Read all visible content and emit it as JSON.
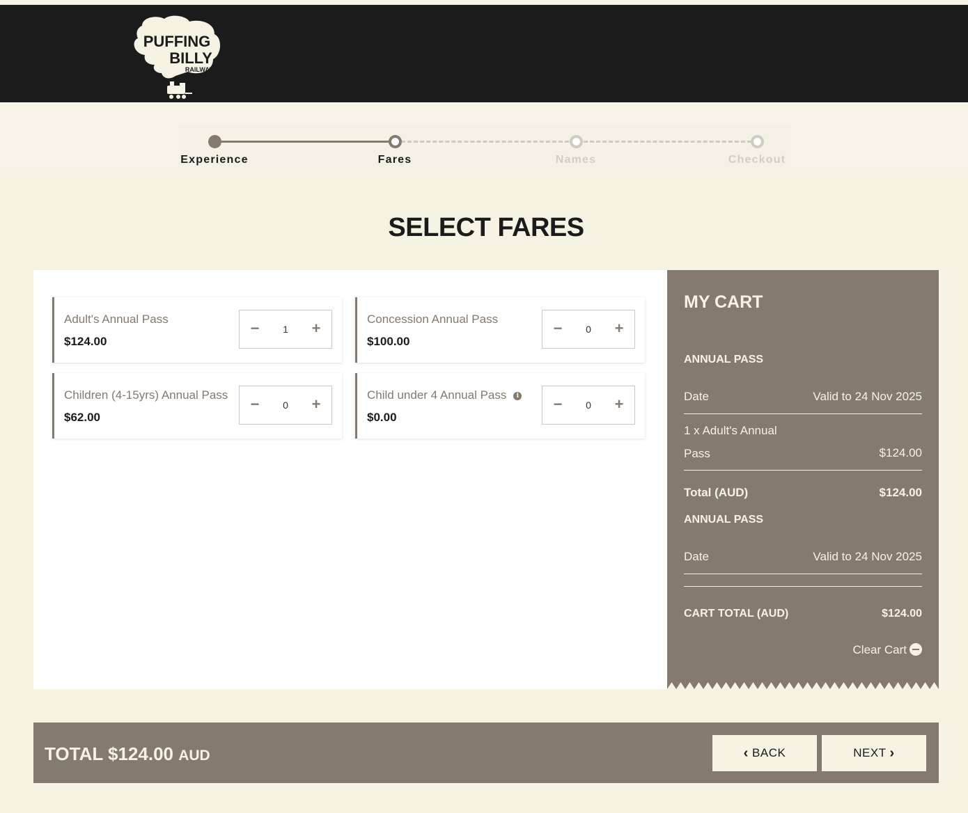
{
  "brand": {
    "logo_line1": "PUFFING",
    "logo_line2": "BILLY",
    "logo_line3": "RAILWAY"
  },
  "steps": [
    {
      "label": "Experience",
      "state": "done"
    },
    {
      "label": "Fares",
      "state": "current"
    },
    {
      "label": "Names",
      "state": "todo"
    },
    {
      "label": "Checkout",
      "state": "todo"
    }
  ],
  "page_title": "SELECT FARES",
  "fares": [
    {
      "name": "Adult's Annual Pass",
      "price": "$124.00",
      "qty": "1",
      "info": false
    },
    {
      "name": "Concession Annual Pass",
      "price": "$100.00",
      "qty": "0",
      "info": false
    },
    {
      "name": "Children (4-15yrs) Annual Pass",
      "price": "$62.00",
      "qty": "0",
      "info": false
    },
    {
      "name": "Child under 4 Annual Pass",
      "price": "$0.00",
      "qty": "0",
      "info": true
    }
  ],
  "stepper": {
    "minus": "−",
    "plus": "+"
  },
  "info_icon_glyph": "i",
  "cart": {
    "title": "MY CART",
    "sections": [
      {
        "heading": "ANNUAL PASS",
        "date_label": "Date",
        "date_value": "Valid to 24 Nov 2025",
        "item_line1": "1 x Adult's Annual",
        "item_line2": "Pass",
        "item_price": "$124.00",
        "total_label": "Total (AUD)",
        "total_value": "$124.00"
      },
      {
        "heading": "ANNUAL PASS",
        "date_label": "Date",
        "date_value": "Valid to 24 Nov 2025"
      }
    ],
    "cart_total_label": "CART TOTAL (AUD)",
    "cart_total_value": "$124.00",
    "clear_label": "Clear Cart"
  },
  "footer": {
    "total_prefix": "TOTAL $124.00",
    "total_currency": "AUD",
    "back_label": "BACK",
    "next_label": "NEXT"
  },
  "colors": {
    "accent": "#847a70",
    "background": "#f6f2e4",
    "header": "#1b1b1b"
  }
}
